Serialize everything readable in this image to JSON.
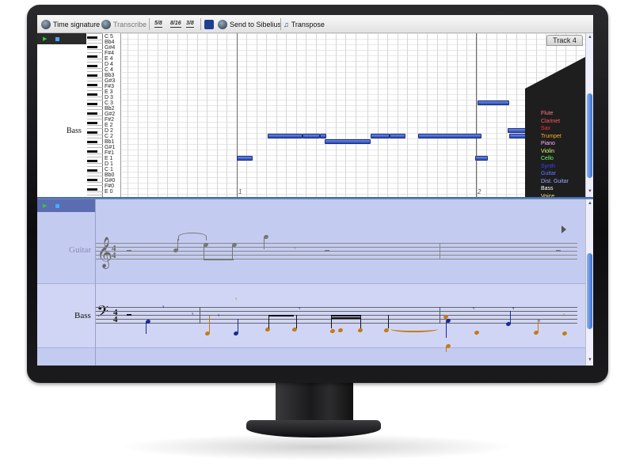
{
  "toolbar": {
    "time_signature": "Time signature",
    "transcribe": "Transcribe",
    "send_to_sibelius": "Send to Sibelius",
    "transpose": "Transpose",
    "mini_icons": [
      "5/8",
      "8/16",
      "3/8"
    ]
  },
  "piano_roll": {
    "staff_label": "Bass",
    "track_tab": "Track 4",
    "pitch_labels": [
      "C 5",
      "Bb4",
      "G#4",
      "F#4",
      "E 4",
      "D 4",
      "C 4",
      "Bb3",
      "G#3",
      "F#3",
      "E 3",
      "D 3",
      "C 3",
      "Bb2",
      "G#2",
      "F#2",
      "E 2",
      "D 2",
      "C 2",
      "Bb1",
      "G#1",
      "F#1",
      "E 1",
      "D 1",
      "C 1",
      "Bb0",
      "G#0",
      "F#0",
      "E 0"
    ],
    "bar_numbers": [
      "1",
      "2"
    ],
    "instruments": [
      {
        "name": "Flute",
        "color": "#ff7a7a"
      },
      {
        "name": "Clarinet",
        "color": "#ff5a5a"
      },
      {
        "name": "Sax",
        "color": "#ff3030"
      },
      {
        "name": "Trumpet",
        "color": "#ffb020"
      },
      {
        "name": "Piano",
        "color": "#ffb0ff"
      },
      {
        "name": "Violin",
        "color": "#d8ff70"
      },
      {
        "name": "Cello",
        "color": "#70ff70"
      },
      {
        "name": "Synth",
        "color": "#3f3fff"
      },
      {
        "name": "Guitar",
        "color": "#5a7aff"
      },
      {
        "name": "Dist. Guitar",
        "color": "#9aa8ff"
      },
      {
        "name": "Bass",
        "color": "#ffffff"
      },
      {
        "name": "Voice",
        "color": "#ffe86a"
      }
    ]
  },
  "score": {
    "staves": [
      {
        "name": "Guitar",
        "time_signature": [
          "4",
          "4"
        ]
      },
      {
        "name": "Bass",
        "time_signature": [
          "4",
          "4"
        ]
      }
    ]
  },
  "colors": {
    "note_blue": "#2947b3",
    "score_background": "#c4cbf0",
    "bass_note_blue": "#1a2a9a",
    "bass_note_orange": "#c87a10"
  }
}
